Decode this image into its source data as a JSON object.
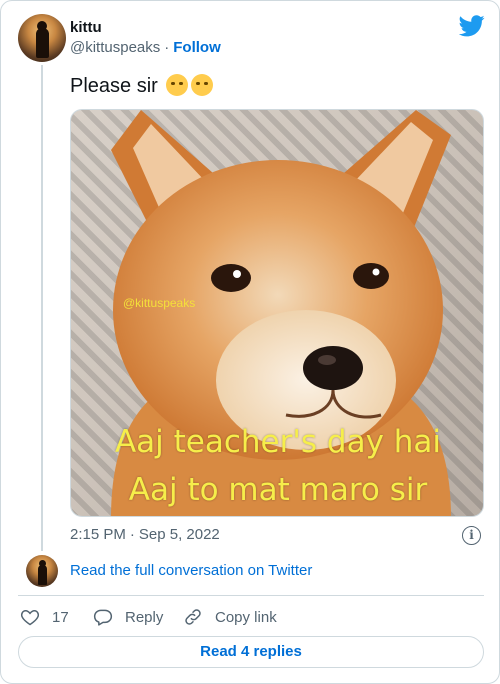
{
  "author": {
    "display_name": "kittu",
    "handle": "@kittuspeaks",
    "separator": "·",
    "follow_label": "Follow"
  },
  "tweet": {
    "text": "Please sir",
    "emoji_icons": [
      "sneezing-face-icon",
      "face-with-rolling-eyes-icon"
    ]
  },
  "media": {
    "watermark": "@kittuspeaks",
    "caption_line1": "Aaj teacher's day hai",
    "caption_line2": "Aaj to mat maro sir"
  },
  "meta": {
    "time": "2:15 PM",
    "separator": "·",
    "date": "Sep 5, 2022"
  },
  "conversation": {
    "read_full_label": "Read the full conversation on Twitter"
  },
  "actions": {
    "like_count": "17",
    "reply_label": "Reply",
    "copy_link_label": "Copy link"
  },
  "footer": {
    "read_replies_label": "Read 4 replies"
  },
  "colors": {
    "link_blue": "#006fd6",
    "twitter_blue": "#1d9bf0",
    "secondary_text": "#536471",
    "border": "#cfd9de",
    "caption_yellow": "#f6ee4a"
  }
}
